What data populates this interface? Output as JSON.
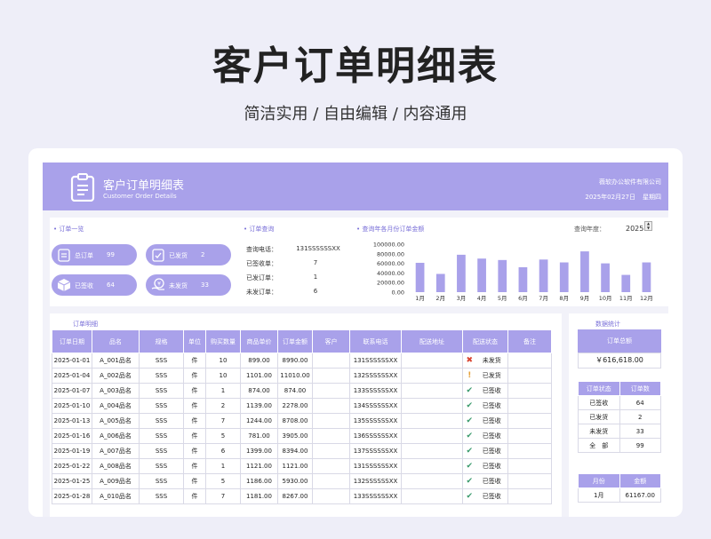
{
  "page": {
    "title": "客户订单明细表",
    "subtitle": "简洁实用 / 自由编辑 / 内容通用"
  },
  "banner": {
    "title": "客户订单明细表",
    "subtitle": "Customer Order Details",
    "company": "薇软办公软件有限公司",
    "date": "2025年02月27日",
    "weekday": "星期四"
  },
  "overview": {
    "label": "• 订单一览",
    "cards": [
      {
        "label": "总订单",
        "value": "99",
        "icon": "clipboard-icon"
      },
      {
        "label": "已发货",
        "value": "2",
        "icon": "check-clipboard-icon"
      },
      {
        "label": "已签收",
        "value": "64",
        "icon": "box-icon"
      },
      {
        "label": "未发货",
        "value": "33",
        "icon": "yen-hand-icon"
      }
    ]
  },
  "query": {
    "label": "• 订单查询",
    "rows": [
      {
        "label": "查询电话：",
        "value": "131SSSSSSXX"
      },
      {
        "label": "已签收单：",
        "value": "7"
      },
      {
        "label": "已发订单：",
        "value": "1"
      },
      {
        "label": "未发订单：",
        "value": "6"
      }
    ]
  },
  "monthly": {
    "label": "• 查询年各月份订单金额",
    "year_label": "查询年度：",
    "year": "2025",
    "spin_up": "▲",
    "spin_down": "▼"
  },
  "chart_data": {
    "type": "bar",
    "categories": [
      "1月",
      "2月",
      "3月",
      "4月",
      "5月",
      "6月",
      "7月",
      "8月",
      "9月",
      "10月",
      "11月",
      "12月"
    ],
    "values": [
      61167,
      38000,
      78000,
      70000,
      67000,
      52000,
      68000,
      62000,
      85000,
      60000,
      36000,
      62000
    ],
    "y_ticks": [
      "100000.00",
      "80000.00",
      "60000.00",
      "40000.00",
      "20000.00",
      "0.00"
    ],
    "ylim": [
      0,
      100000
    ],
    "color": "#a9a1ea"
  },
  "details": {
    "label": "订单明细",
    "headers": [
      "订单日期",
      "品名",
      "规格",
      "单位",
      "购买数量",
      "商品单价",
      "订单金额",
      "客户",
      "联系电话",
      "配送地址",
      "配送状态",
      "备注"
    ],
    "rows": [
      {
        "date": "2025-01-01",
        "name": "A_001品名",
        "spec": "SSS",
        "unit": "件",
        "qty": "10",
        "price": "899.00",
        "amount": "8990.00",
        "customer": "",
        "phone": "131SSSSSSXX",
        "address": "",
        "mark": "✖",
        "mark_color": "#d9432f",
        "status": "未发货",
        "note": ""
      },
      {
        "date": "2025-01-04",
        "name": "A_002品名",
        "spec": "SSS",
        "unit": "件",
        "qty": "10",
        "price": "1101.00",
        "amount": "11010.00",
        "customer": "",
        "phone": "132SSSSSSXX",
        "address": "",
        "mark": "!",
        "mark_color": "#e6a23c",
        "status": "已发货",
        "note": ""
      },
      {
        "date": "2025-01-07",
        "name": "A_003品名",
        "spec": "SSS",
        "unit": "件",
        "qty": "1",
        "price": "874.00",
        "amount": "874.00",
        "customer": "",
        "phone": "133SSSSSSXX",
        "address": "",
        "mark": "✔",
        "mark_color": "#3a9a6c",
        "status": "已签收",
        "note": ""
      },
      {
        "date": "2025-01-10",
        "name": "A_004品名",
        "spec": "SSS",
        "unit": "件",
        "qty": "2",
        "price": "1139.00",
        "amount": "2278.00",
        "customer": "",
        "phone": "134SSSSSSXX",
        "address": "",
        "mark": "✔",
        "mark_color": "#3a9a6c",
        "status": "已签收",
        "note": ""
      },
      {
        "date": "2025-01-13",
        "name": "A_005品名",
        "spec": "SSS",
        "unit": "件",
        "qty": "7",
        "price": "1244.00",
        "amount": "8708.00",
        "customer": "",
        "phone": "135SSSSSSXX",
        "address": "",
        "mark": "✔",
        "mark_color": "#3a9a6c",
        "status": "已签收",
        "note": ""
      },
      {
        "date": "2025-01-16",
        "name": "A_006品名",
        "spec": "SSS",
        "unit": "件",
        "qty": "5",
        "price": "781.00",
        "amount": "3905.00",
        "customer": "",
        "phone": "136SSSSSSXX",
        "address": "",
        "mark": "✔",
        "mark_color": "#3a9a6c",
        "status": "已签收",
        "note": ""
      },
      {
        "date": "2025-01-19",
        "name": "A_007品名",
        "spec": "SSS",
        "unit": "件",
        "qty": "6",
        "price": "1399.00",
        "amount": "8394.00",
        "customer": "",
        "phone": "137SSSSSSXX",
        "address": "",
        "mark": "✔",
        "mark_color": "#3a9a6c",
        "status": "已签收",
        "note": ""
      },
      {
        "date": "2025-01-22",
        "name": "A_008品名",
        "spec": "SSS",
        "unit": "件",
        "qty": "1",
        "price": "1121.00",
        "amount": "1121.00",
        "customer": "",
        "phone": "131SSSSSSXX",
        "address": "",
        "mark": "✔",
        "mark_color": "#3a9a6c",
        "status": "已签收",
        "note": ""
      },
      {
        "date": "2025-01-25",
        "name": "A_009品名",
        "spec": "SSS",
        "unit": "件",
        "qty": "5",
        "price": "1186.00",
        "amount": "5930.00",
        "customer": "",
        "phone": "132SSSSSSXX",
        "address": "",
        "mark": "✔",
        "mark_color": "#3a9a6c",
        "status": "已签收",
        "note": ""
      },
      {
        "date": "2025-01-28",
        "name": "A_010品名",
        "spec": "SSS",
        "unit": "件",
        "qty": "7",
        "price": "1181.00",
        "amount": "8267.00",
        "customer": "",
        "phone": "133SSSSSSXX",
        "address": "",
        "mark": "✔",
        "mark_color": "#3a9a6c",
        "status": "已签收",
        "note": ""
      }
    ]
  },
  "stats": {
    "label": "数据统计",
    "total_label": "订单总额",
    "total_value": "￥616,618.00",
    "status_headers": [
      "订单状态",
      "订单数"
    ],
    "status_rows": [
      {
        "status": "已签收",
        "count": "64"
      },
      {
        "status": "已发货",
        "count": "2"
      },
      {
        "status": "未发货",
        "count": "33"
      },
      {
        "status": "全　部",
        "count": "99"
      }
    ],
    "month_headers": [
      "月份",
      "金额"
    ],
    "month_rows": [
      {
        "month": "1月",
        "amount": "61167.00"
      }
    ]
  }
}
